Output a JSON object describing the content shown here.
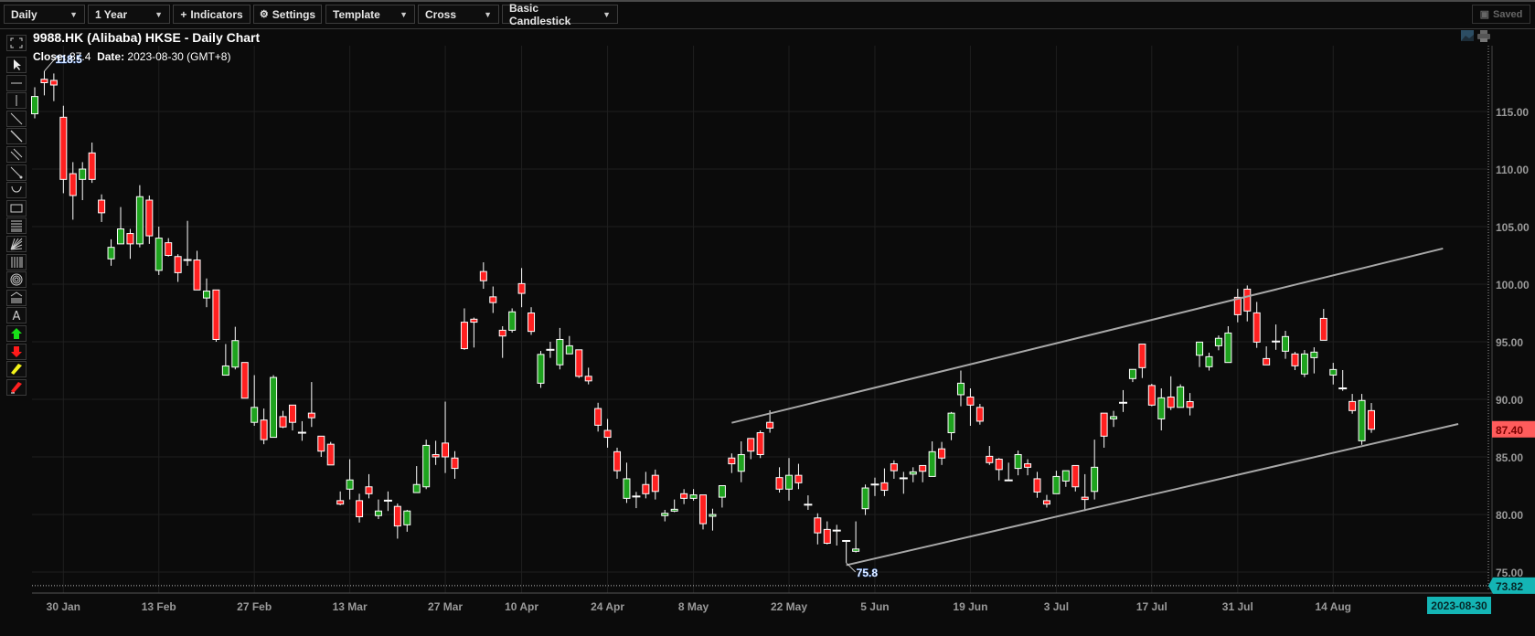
{
  "toolbar": {
    "interval": "Daily",
    "range": "1 Year",
    "indicators_label": "Indicators",
    "settings_label": "Settings",
    "template_label": "Template",
    "crosshair": "Cross",
    "chart_style": "Basic Candlestick",
    "saved_label": "Saved"
  },
  "header": {
    "title": "9988.HK (Alibaba) HKSE - Daily Chart",
    "close_label": "Close:",
    "close_value": "87.4",
    "date_label": "Date:",
    "date_value": "2023-08-30 (GMT+8)"
  },
  "left_tools": [
    "fullscreen-icon",
    "pointer-icon",
    "horizontal-line-icon",
    "vertical-line-icon",
    "trend-line-icon",
    "ray-line-icon",
    "parallel-channel-icon",
    "arrow-line-icon",
    "arc-icon",
    "rectangle-icon",
    "fibonacci-retracement-icon",
    "gann-fan-icon",
    "fibonacci-time-zones-icon",
    "fibonacci-circles-icon",
    "fibonacci-arcs-icon",
    "text-icon",
    "buy-arrow-icon",
    "sell-arrow-icon",
    "highlighter-icon",
    "eraser-icon"
  ],
  "colors": {
    "up": "#1ea31e",
    "down": "#ff2020",
    "background": "#0b0b0b",
    "last_price": "#ff5c5c",
    "crosshair_label": "#14b5b5",
    "trendline": "#a8a8a8"
  },
  "chart_data": {
    "type": "candlestick",
    "title": "9988.HK (Alibaba) HKSE - Daily Chart",
    "ohlc_fields": [
      "open",
      "high",
      "low",
      "close"
    ],
    "candles": [
      [
        114.8,
        117.1,
        114.4,
        116.3
      ],
      [
        117.8,
        118.5,
        116.4,
        117.5
      ],
      [
        117.7,
        118.3,
        115.9,
        117.3
      ],
      [
        114.5,
        115.5,
        107.9,
        109.1
      ],
      [
        109.6,
        110.6,
        105.6,
        107.7
      ],
      [
        109.1,
        110.6,
        107.3,
        110.0
      ],
      [
        111.4,
        112.3,
        108.8,
        109.1
      ],
      [
        107.3,
        107.8,
        105.4,
        106.2
      ],
      [
        102.2,
        103.9,
        101.6,
        103.2
      ],
      [
        103.5,
        106.7,
        103.5,
        104.8
      ],
      [
        104.4,
        104.8,
        102.2,
        103.5
      ],
      [
        103.5,
        108.6,
        103.2,
        107.6
      ],
      [
        107.3,
        107.7,
        103.5,
        104.2
      ],
      [
        101.2,
        105.0,
        100.8,
        104.0
      ],
      [
        103.6,
        104.0,
        102.4,
        102.5
      ],
      [
        102.4,
        102.6,
        100.2,
        101.0
      ],
      [
        102.1,
        105.5,
        101.6,
        102.1
      ],
      [
        102.1,
        102.9,
        99.5,
        99.5
      ],
      [
        98.8,
        100.5,
        98.0,
        99.4
      ],
      [
        99.5,
        99.5,
        95.0,
        95.2
      ],
      [
        92.1,
        94.8,
        92.1,
        92.9
      ],
      [
        92.8,
        96.3,
        92.6,
        95.1
      ],
      [
        93.2,
        93.2,
        90.1,
        90.1
      ],
      [
        88.0,
        92.1,
        87.7,
        89.3
      ],
      [
        88.2,
        89.2,
        86.1,
        86.5
      ],
      [
        86.7,
        92.1,
        86.7,
        91.9
      ],
      [
        88.5,
        89.0,
        87.5,
        87.6
      ],
      [
        89.5,
        89.5,
        87.3,
        88.0
      ],
      [
        87.1,
        88.1,
        86.4,
        87.1
      ],
      [
        88.8,
        91.5,
        87.6,
        88.4
      ],
      [
        86.8,
        86.8,
        85.0,
        85.5
      ],
      [
        86.1,
        86.3,
        84.3,
        84.3
      ],
      [
        81.2,
        82.0,
        80.8,
        80.9
      ],
      [
        82.2,
        84.8,
        81.3,
        83.0
      ],
      [
        81.2,
        81.8,
        79.3,
        79.8
      ],
      [
        82.4,
        83.5,
        81.4,
        81.8
      ],
      [
        79.9,
        81.3,
        79.6,
        80.3
      ],
      [
        81.2,
        82.0,
        80.3,
        81.2
      ],
      [
        80.7,
        80.95,
        77.9,
        79.0
      ],
      [
        79.1,
        80.4,
        78.5,
        80.3
      ],
      [
        81.9,
        84.2,
        81.9,
        82.6
      ],
      [
        82.4,
        86.5,
        82.2,
        86.0
      ],
      [
        85.2,
        86.4,
        84.3,
        85.0
      ],
      [
        86.2,
        89.8,
        83.6,
        85.0
      ],
      [
        84.9,
        85.5,
        83.1,
        84.0
      ],
      [
        96.7,
        97.9,
        94.3,
        94.4
      ],
      [
        96.96,
        97.1,
        94.5,
        96.7
      ],
      [
        101.1,
        101.9,
        99.6,
        100.3
      ],
      [
        98.9,
        99.8,
        97.5,
        98.4
      ],
      [
        96.0,
        96.35,
        93.6,
        95.5
      ],
      [
        96.0,
        97.9,
        95.8,
        97.6
      ],
      [
        100.05,
        101.4,
        98.0,
        99.2
      ],
      [
        97.5,
        98.0,
        95.6,
        95.9
      ],
      [
        91.4,
        94.2,
        91.0,
        93.9
      ],
      [
        94.3,
        95.0,
        93.6,
        94.3
      ],
      [
        93.0,
        96.2,
        92.6,
        95.2
      ],
      [
        93.95,
        95.5,
        93.95,
        94.65
      ],
      [
        94.3,
        94.3,
        91.85,
        92.0
      ],
      [
        92.0,
        92.75,
        91.3,
        91.6
      ],
      [
        89.2,
        89.7,
        87.2,
        87.75
      ],
      [
        87.3,
        88.3,
        85.8,
        86.7
      ],
      [
        85.45,
        85.8,
        83.1,
        83.8
      ],
      [
        81.4,
        84.5,
        81.0,
        83.1
      ],
      [
        81.56,
        81.96,
        80.55,
        81.56
      ],
      [
        82.6,
        83.7,
        81.4,
        81.8
      ],
      [
        83.4,
        83.9,
        81.3,
        82.0
      ],
      [
        79.9,
        80.4,
        79.4,
        80.1
      ],
      [
        80.3,
        81.3,
        80.2,
        80.45
      ],
      [
        81.8,
        82.2,
        80.9,
        81.4
      ],
      [
        81.4,
        82.2,
        81.2,
        81.7
      ],
      [
        81.7,
        81.7,
        78.7,
        79.2
      ],
      [
        79.9,
        80.5,
        78.6,
        80.0
      ],
      [
        81.5,
        82.5,
        80.6,
        82.5
      ],
      [
        84.9,
        85.3,
        83.6,
        84.4
      ],
      [
        83.75,
        86.35,
        82.8,
        85.2
      ],
      [
        86.6,
        86.6,
        84.8,
        85.5
      ],
      [
        87.1,
        87.3,
        84.9,
        85.2
      ],
      [
        88.0,
        89.05,
        87.1,
        87.5
      ],
      [
        83.2,
        84.1,
        81.9,
        82.2
      ],
      [
        82.2,
        84.9,
        81.2,
        83.4
      ],
      [
        83.4,
        84.4,
        82.2,
        82.75
      ],
      [
        80.85,
        81.66,
        80.4,
        80.85
      ],
      [
        79.7,
        80.1,
        77.4,
        78.4
      ],
      [
        78.7,
        79.4,
        77.4,
        77.5
      ],
      [
        78.6,
        79.1,
        77.3,
        78.6
      ],
      [
        77.7,
        77.7,
        75.8,
        77.7
      ],
      [
        76.8,
        79.4,
        76.7,
        77.0
      ],
      [
        80.5,
        82.6,
        79.95,
        82.3
      ],
      [
        82.6,
        83.2,
        81.6,
        82.6
      ],
      [
        82.75,
        84.0,
        81.6,
        82.1
      ],
      [
        84.4,
        84.7,
        83.1,
        83.8
      ],
      [
        83.14,
        83.7,
        81.8,
        83.14
      ],
      [
        83.5,
        84.1,
        82.8,
        83.7
      ],
      [
        84.25,
        84.25,
        82.8,
        83.75
      ],
      [
        83.3,
        86.35,
        83.3,
        85.45
      ],
      [
        85.7,
        86.3,
        84.3,
        84.9
      ],
      [
        87.1,
        88.9,
        86.45,
        88.8
      ],
      [
        90.4,
        92.5,
        89.4,
        91.4
      ],
      [
        90.2,
        90.95,
        87.7,
        89.5
      ],
      [
        89.3,
        89.6,
        87.8,
        88.1
      ],
      [
        85.05,
        85.95,
        84.3,
        84.5
      ],
      [
        84.8,
        84.9,
        82.96,
        83.9
      ],
      [
        82.96,
        84.5,
        82.96,
        82.96
      ],
      [
        84.0,
        85.55,
        83.4,
        85.2
      ],
      [
        84.4,
        84.8,
        83.4,
        84.1
      ],
      [
        83.1,
        83.7,
        81.45,
        81.95
      ],
      [
        81.2,
        81.7,
        80.6,
        80.9
      ],
      [
        81.8,
        83.8,
        81.8,
        83.3
      ],
      [
        82.9,
        83.8,
        82.4,
        83.8
      ],
      [
        84.25,
        84.25,
        82.0,
        82.4
      ],
      [
        81.5,
        83.5,
        80.3,
        81.3
      ],
      [
        82.0,
        86.5,
        81.3,
        84.1
      ],
      [
        88.8,
        88.8,
        85.8,
        86.8
      ],
      [
        88.3,
        89.0,
        87.6,
        88.5
      ],
      [
        89.7,
        90.8,
        88.9,
        89.7
      ],
      [
        91.8,
        92.6,
        91.5,
        92.6
      ],
      [
        94.8,
        94.8,
        91.85,
        92.75
      ],
      [
        91.2,
        91.35,
        89.4,
        89.5
      ],
      [
        88.3,
        90.95,
        87.3,
        90.13
      ],
      [
        90.2,
        92.0,
        89.07,
        89.3
      ],
      [
        89.3,
        91.3,
        89.3,
        91.08
      ],
      [
        89.8,
        90.55,
        88.6,
        89.3
      ],
      [
        93.83,
        94.97,
        92.8,
        94.97
      ],
      [
        92.83,
        94.05,
        92.5,
        93.7
      ],
      [
        94.65,
        95.55,
        94.26,
        95.3
      ],
      [
        93.2,
        96.35,
        93.2,
        95.76
      ],
      [
        98.86,
        99.6,
        96.69,
        97.35
      ],
      [
        99.57,
        99.89,
        96.77,
        97.67
      ],
      [
        97.51,
        98.46,
        94.47,
        94.97
      ],
      [
        93.54,
        94.6,
        92.99,
        92.99
      ],
      [
        95.02,
        96.5,
        94.3,
        95.02
      ],
      [
        94.18,
        95.95,
        93.52,
        95.45
      ],
      [
        93.94,
        94.12,
        92.54,
        92.91
      ],
      [
        92.2,
        94.28,
        91.93,
        93.94
      ],
      [
        93.62,
        94.52,
        92.25,
        94.1
      ],
      [
        97.03,
        97.85,
        95.13,
        95.13
      ],
      [
        92.11,
        93.17,
        91.29,
        92.59
      ],
      [
        90.95,
        92.54,
        90.74,
        90.95
      ],
      [
        89.81,
        90.47,
        88.75,
        89.02
      ],
      [
        86.4,
        90.47,
        86.05,
        89.9
      ],
      [
        89.02,
        89.68,
        87.09,
        87.4
      ]
    ],
    "x_ticks": [
      {
        "label": "30 Jan",
        "bar": 3
      },
      {
        "label": "13 Feb",
        "bar": 13
      },
      {
        "label": "27 Feb",
        "bar": 23
      },
      {
        "label": "13 Mar",
        "bar": 33
      },
      {
        "label": "27 Mar",
        "bar": 43
      },
      {
        "label": "10 Apr",
        "bar": 51
      },
      {
        "label": "24 Apr",
        "bar": 60
      },
      {
        "label": "8 May",
        "bar": 69
      },
      {
        "label": "22 May",
        "bar": 79
      },
      {
        "label": "5 Jun",
        "bar": 88
      },
      {
        "label": "19 Jun",
        "bar": 98
      },
      {
        "label": "3 Jul",
        "bar": 107
      },
      {
        "label": "17 Jul",
        "bar": 117
      },
      {
        "label": "31 Jul",
        "bar": 126
      },
      {
        "label": "14 Aug",
        "bar": 136
      }
    ],
    "y_ticks": [
      "115.00",
      "110.00",
      "105.00",
      "100.00",
      "95.00",
      "90.00",
      "85.00",
      "80.00",
      "75.00"
    ],
    "ylim": [
      73.5,
      120
    ],
    "grid": true,
    "last_price_label": "87.40",
    "crosshair_price_label": "73.82",
    "crosshair_date_label": "2023-08-30",
    "annotations": [
      {
        "label": "118.5",
        "bar": 1,
        "price": 118.5,
        "kind": "high"
      },
      {
        "label": "75.8",
        "bar": 85,
        "price": 75.8,
        "kind": "low"
      }
    ],
    "trendlines": [
      {
        "start": {
          "bar": 73,
          "price": 87.96
        },
        "end": {
          "bar": 147.5,
          "price": 103.1
        }
      },
      {
        "start": {
          "bar": 85,
          "price": 75.6
        },
        "end": {
          "bar": 149.1,
          "price": 87.86
        }
      }
    ]
  }
}
